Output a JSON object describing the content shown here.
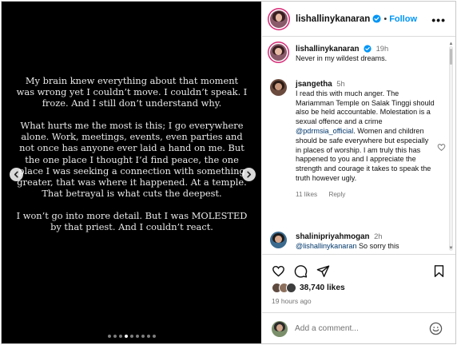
{
  "post": {
    "paragraphs": [
      "My brain knew everything about that moment was wrong yet I couldn’t move. I couldn’t speak. I froze. And I still don’t understand why.",
      "What hurts me the most is this; I go everywhere alone. Work, meetings, events, even parties and not once has anyone ever laid a hand on me. But the one place I thought I’d find peace, the one place I was seeking a connection with something greater, that was where it happened. At a temple. That betrayal is what cuts the deepest.",
      "I won’t go into more detail. But I was MOLESTED by that priest. And I couldn’t react."
    ],
    "carousel": {
      "total_dots": 9,
      "active_index": 3
    },
    "prev_icon": "chevron-left-icon",
    "next_icon": "chevron-right-icon"
  },
  "header": {
    "username": "lishallinykanaran",
    "separator": "•",
    "follow_label": "Follow",
    "more_label": "•••"
  },
  "caption": {
    "username": "lishallinykanaran",
    "time": "19h",
    "text": "Never in my wildest dreams."
  },
  "comments": [
    {
      "username": "jsangetha",
      "time": "5h",
      "text_before": "I read this with much anger. The Mariamman Temple on Salak Tinggi should also be held accountable. Molestation is a sexual offence and a crime ",
      "mention": "@pdrmsia_official",
      "text_after": ". Women and children should be safe everywhere but especially in places of worship. I am truly this has happened to you and I appreciate the strength and courage it takes to speak the truth however ugly.",
      "likes": "11 likes",
      "reply_label": "Reply"
    },
    {
      "username": "shalinipriyahmogan",
      "time": "2h",
      "mention": "@lishallinykanaran",
      "text_after": " So sorry this"
    }
  ],
  "footer": {
    "likes_count": "38,740 likes",
    "time_ago": "19 hours ago",
    "comment_placeholder": "Add a comment..."
  },
  "colors": {
    "accent_blue": "#0095f6",
    "mention_blue": "#00376b",
    "secondary_text": "#737373",
    "story_ring": "#d62976"
  }
}
